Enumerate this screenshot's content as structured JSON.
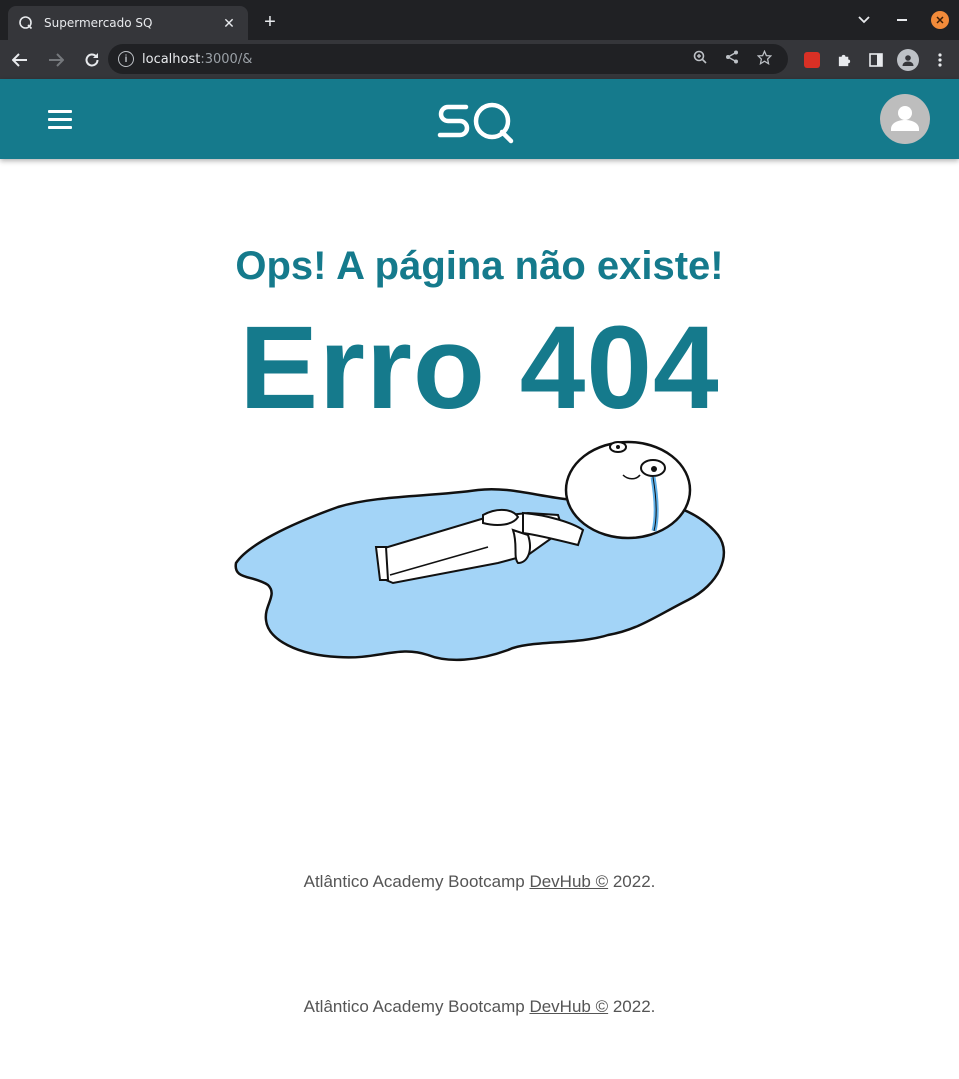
{
  "browser": {
    "tab_title": "Supermercado SQ",
    "tab_close": "✕",
    "new_tab": "+",
    "url_host": "localhost",
    "url_rest": ":3000/&",
    "window_close": "✕",
    "tab_search_icon": "chevron-down-icon",
    "minimize_icon": "minimize-icon"
  },
  "app": {
    "logo_text": "SQ",
    "colors": {
      "primary": "#157a8c",
      "header": "#157a8c",
      "footer_text": "#555555"
    }
  },
  "error": {
    "subtitle": "Ops! A página não existe!",
    "title": "Erro 404"
  },
  "footer": {
    "prefix": "Atlântico Academy Bootcamp ",
    "link": "DevHub ©",
    "suffix": " 2022."
  }
}
